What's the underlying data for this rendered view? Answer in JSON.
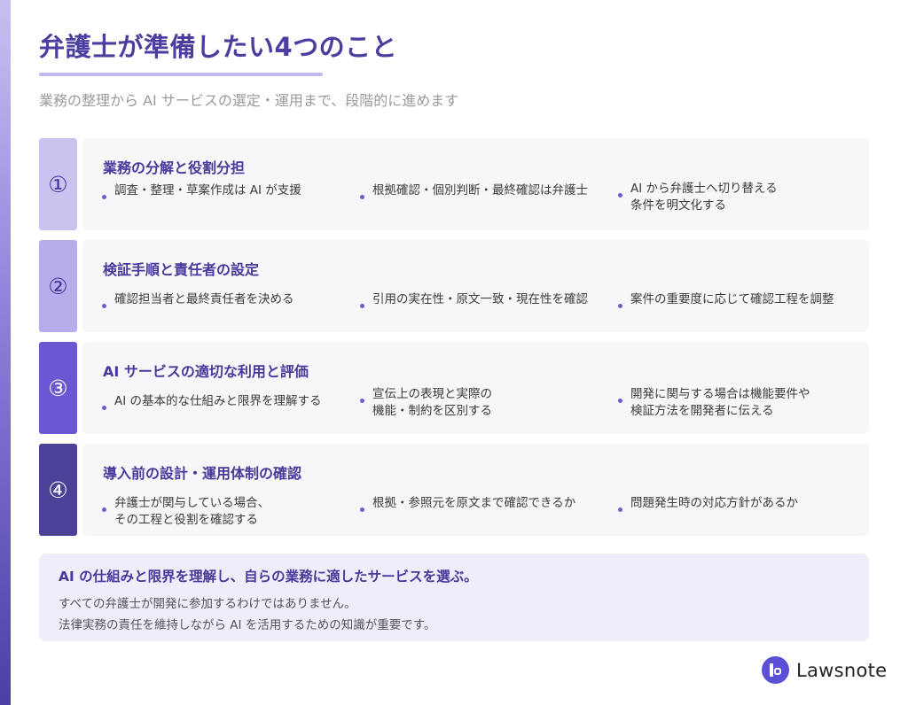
{
  "header": {
    "title": "弁護士が準備したい4つのこと",
    "subtitle": "業務の整理から AI サービスの選定・運用まで、段階的に進めます"
  },
  "steps": [
    {
      "number": "①",
      "title": "業務の分解と役割分担",
      "accent": "#cbc2f0",
      "number_color": "#3f3596",
      "bullets": [
        "調査・整理・草案作成は AI が支援",
        "根拠確認・個別判断・最終確認は弁護士",
        "AI から弁護士へ切り替える\n条件を明文化する"
      ]
    },
    {
      "number": "②",
      "title": "検証手順と責任者の設定",
      "accent": "#b8acec",
      "number_color": "#3f3596",
      "bullets": [
        "確認担当者と最終責任者を決める",
        "引用の実在性・原文一致・現在性を確認",
        "案件の重要度に応じて確認工程を調整"
      ]
    },
    {
      "number": "③",
      "title": "AI サービスの適切な利用と評価",
      "accent": "#6b57d2",
      "number_color": "#ffffff",
      "bullets": [
        "AI の基本的な仕組みと限界を理解する",
        "宣伝上の表現と実際の\n機能・制約を区別する",
        "開発に関与する場合は機能要件や\n検証方法を開発者に伝える"
      ]
    },
    {
      "number": "④",
      "title": "導入前の設計・運用体制の確認",
      "accent": "#4c4199",
      "number_color": "#ffffff",
      "bullets": [
        "弁護士が関与している場合、\nその工程と役割を確認する",
        "根拠・参照元を原文まで確認できるか",
        "問題発生時の対応方針があるか"
      ]
    }
  ],
  "summary": {
    "headline": "AI の仕組みと限界を理解し、自らの業務に適したサービスを選ぶ。",
    "lines": [
      "すべての弁護士が開発に参加するわけではありません。",
      "法律実務の責任を維持しながら AI を活用するための知識が重要です。"
    ]
  },
  "brand": {
    "name": "Lawsnote",
    "logo_icon": "lawsnote-logo-icon"
  },
  "colors": {
    "title": "#4a3ea0",
    "bullet_dot": "#6e5ccd",
    "summary_bg": "#f0edfb",
    "brand": "#5a4fd6"
  }
}
